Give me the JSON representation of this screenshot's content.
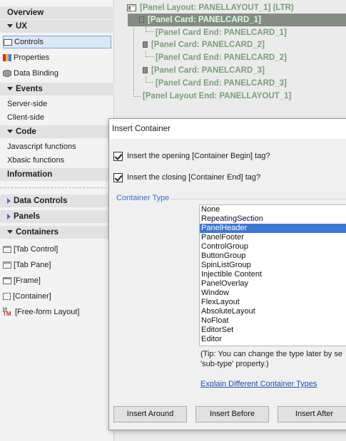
{
  "left_panel": {
    "overview": "Overview",
    "ux_header": "UX",
    "ux_items": [
      "Controls",
      "Properties",
      "Data Binding"
    ],
    "events_header": "Events",
    "events_items": [
      "Server-side",
      "Client-side"
    ],
    "code_header": "Code",
    "code_items": [
      "Javascript functions",
      "Xbasic functions"
    ],
    "information_header": "Information",
    "data_controls_header": "Data Controls",
    "panels_header": "Panels",
    "containers_header": "Containers",
    "container_items": [
      "[Tab Control]",
      "[Tab Pane]",
      "[Frame]",
      "[Container]",
      "[Free-form Layout]"
    ]
  },
  "tree": {
    "rows": [
      "[Panel Layout: PANELLAYOUT_1] (LTR)",
      "[Panel Card: PANELCARD_1]",
      "[Panel Card End: PANELCARD_1]",
      "[Panel Card: PANELCARD_2]",
      "[Panel Card End: PANELCARD_2]",
      "[Panel Card: PANELCARD_3]",
      "[Panel Card End: PANELCARD_3]",
      "[Panel Layout End: PANELLAYOUT_1]"
    ]
  },
  "dialog": {
    "title": "Insert Container",
    "checkbox_begin_label": "Insert the opening [Container Begin] tag?",
    "checkbox_begin_checked": true,
    "checkbox_end_label": "Insert the closing [Container End] tag?",
    "checkbox_end_checked": true,
    "group_label": "Container Type",
    "types": [
      "None",
      "RepeatingSection",
      "PanelHeader",
      "PanelFooter",
      "ControlGroup",
      "ButtonGroup",
      "SpinListGroup",
      "Injectible Content",
      "PanelOverlay",
      "Window",
      "FlexLayout",
      "AbsoluteLayout",
      "NoFloat",
      "EditorSet",
      "Editor"
    ],
    "selected_type": "PanelHeader",
    "tip_line1": "(Tip: You can change the type later  by se",
    "tip_line2": "'sub-type' property.)",
    "explain_link": "Explain Different Container Types",
    "buttons": [
      "Insert Around",
      "Insert Before",
      "Insert After"
    ]
  },
  "colors": {
    "tree_text": "#79a079",
    "tree_highlight_bg": "#848c84",
    "list_selection": "#3b78d4",
    "link": "#1a4fb3"
  }
}
